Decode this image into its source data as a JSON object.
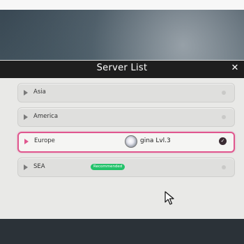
{
  "dialog": {
    "title": "Server List",
    "close_icon": "close-icon"
  },
  "servers": [
    {
      "name": "Asia",
      "selected": false,
      "badge": ""
    },
    {
      "name": "America",
      "selected": false,
      "badge": ""
    },
    {
      "name": "Europe",
      "selected": true,
      "badge": "",
      "player": {
        "name": "gina",
        "level": "Lvl.3"
      }
    },
    {
      "name": "SEA",
      "selected": false,
      "badge": "Recommended"
    }
  ],
  "colors": {
    "accent": "#e0578f",
    "badge": "#23c26a",
    "header": "#1e1e1e",
    "panel": "#e9e9e7"
  }
}
